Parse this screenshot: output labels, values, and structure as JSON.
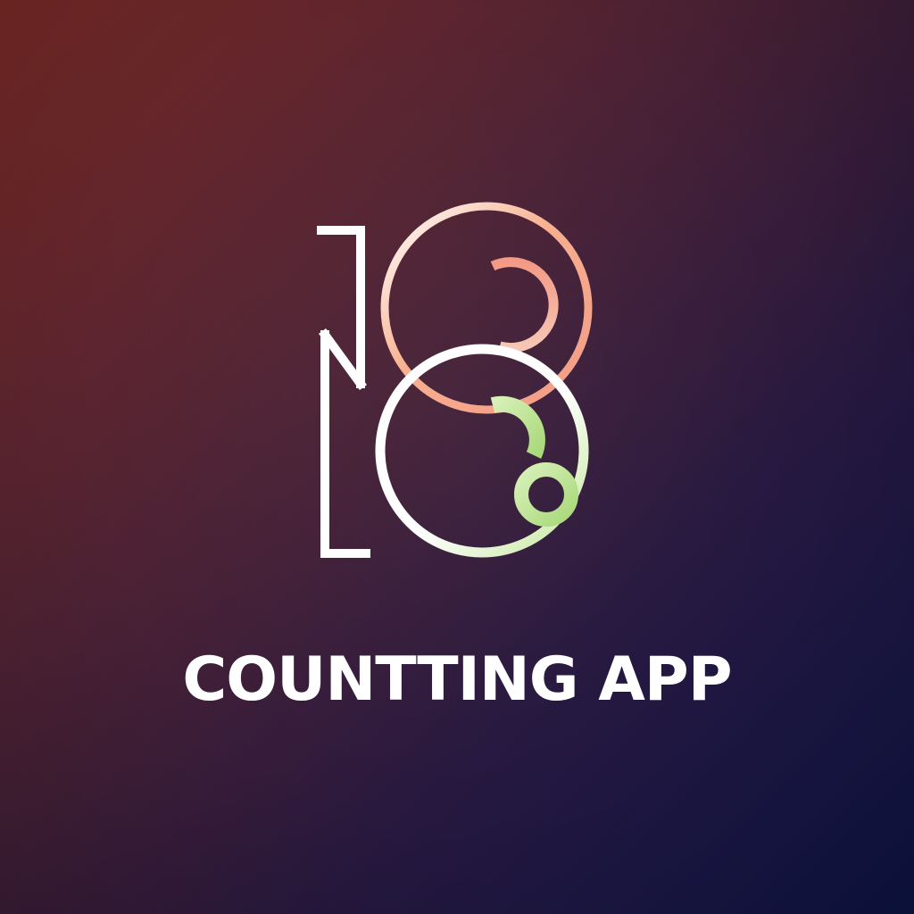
{
  "logo": {
    "icon": "number-18-logo-icon",
    "wordmark": "COUNTTING APP"
  },
  "colors": {
    "background_top_left": "#7a2a26",
    "background_mid": "#3a1c3a",
    "background_bottom_right": "#0d1446",
    "mark_white": "#ffffff",
    "accent_peach": "#f5a483",
    "accent_green": "#b8e08a"
  }
}
